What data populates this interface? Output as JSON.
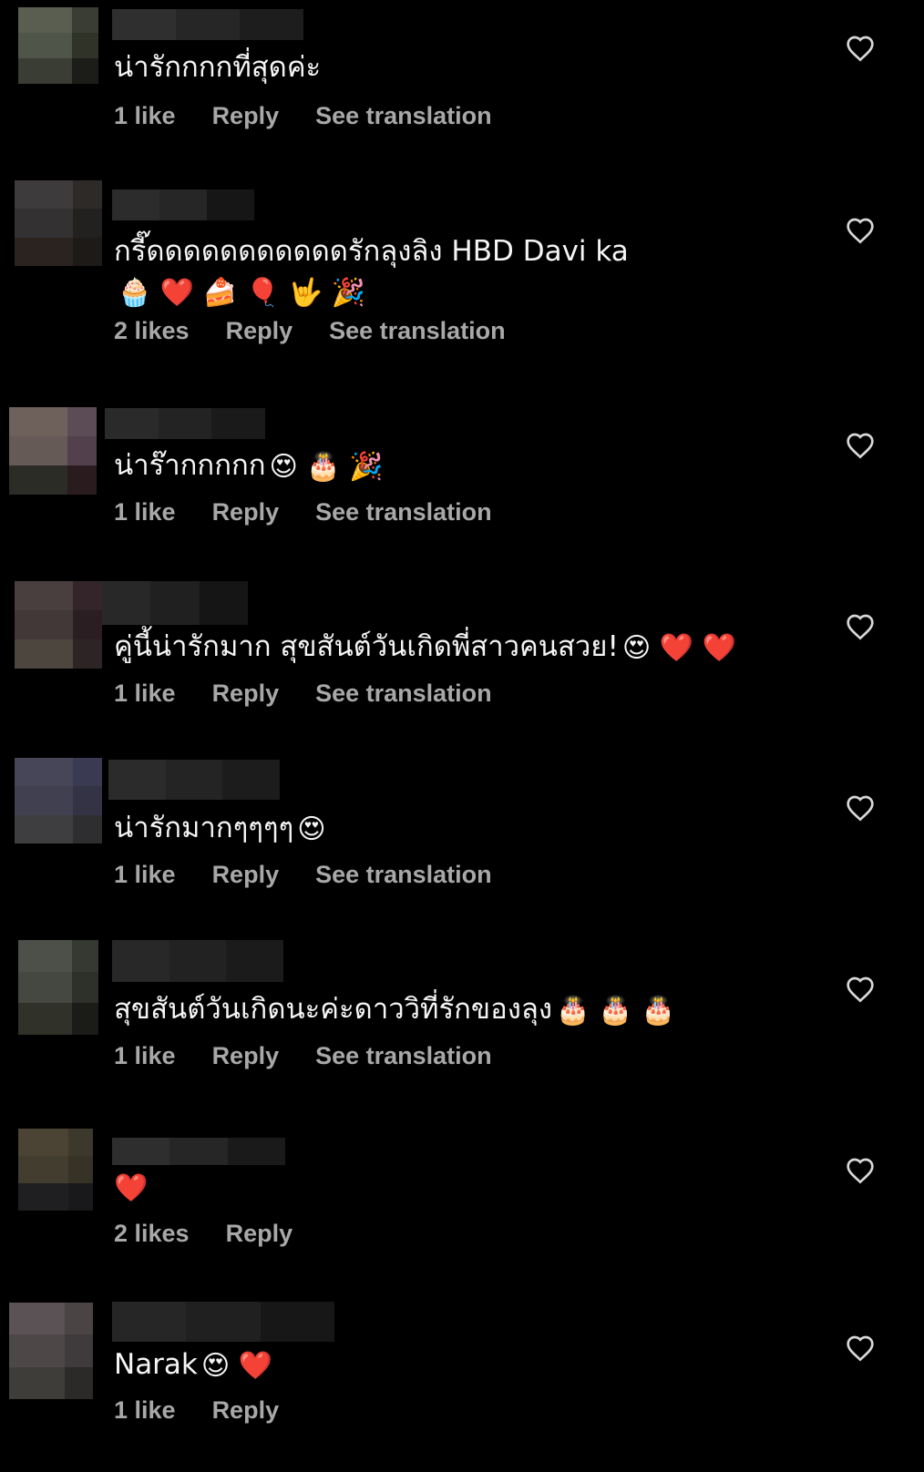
{
  "comments": [
    {
      "text": "น่ารักกกกที่สุดค่ะ",
      "emoji": "",
      "likes": "1 like",
      "reply": "Reply",
      "translation": "See translation",
      "avatar_colors": [
        "#5a5e50",
        "#5a5e50",
        "#3a3d33",
        "#50554a",
        "#50554a",
        "#303328",
        "#3a3d33",
        "#3a3d33",
        "#1c1d18"
      ],
      "bar_colors": [
        "#2f2f2f",
        "#262626",
        "#1d1d1d"
      ]
    },
    {
      "text": "กรี๊ดดดดดดดดดดดรักลุงลิง HBD Davi ka",
      "emoji": "🧁 ❤️ 🍰 🎈 🤟 🎉",
      "likes": "2 likes",
      "reply": "Reply",
      "translation": "See translation",
      "avatar_colors": [
        "#3d3b3b",
        "#3d3b3b",
        "#2e2a28",
        "#333131",
        "#333131",
        "#232020",
        "#2a2320",
        "#2a2320",
        "#1d1a18"
      ],
      "bar_colors": [
        "#2c2c2c",
        "#262626",
        "#161616"
      ]
    },
    {
      "text": "น่าร๊ากกกกก",
      "emoji": "😍 🎂 🎉",
      "likes": "1 like",
      "reply": "Reply",
      "translation": "See translation",
      "avatar_colors": [
        "#6e615b",
        "#6e615b",
        "#5c4c55",
        "#665a57",
        "#665a57",
        "#52414c",
        "#2c2c27",
        "#2c2c27",
        "#2a1c1e"
      ],
      "bar_colors": [
        "#2a2a2a",
        "#232323",
        "#1a1a1a"
      ]
    },
    {
      "text": "คู่นี้น่ารักมาก สุขสันต์วันเกิดพี่สาวคนสวย!",
      "emoji": "😍 ❤️ ❤️",
      "likes": "1 like",
      "reply": "Reply",
      "translation": "See translation",
      "avatar_colors": [
        "#4a3f3f",
        "#4a3f3f",
        "#332529",
        "#433838",
        "#433838",
        "#2a1e22",
        "#4c463f",
        "#4c463f",
        "#2d2426"
      ],
      "bar_colors": [
        "#282828",
        "#202020",
        "#151515"
      ]
    },
    {
      "text": "น่ารักมากๆๆๆๆ",
      "emoji": "😍",
      "likes": "1 like",
      "reply": "Reply",
      "translation": "See translation",
      "avatar_colors": [
        "#474659",
        "#474659",
        "#3a3a53",
        "#404050",
        "#404050",
        "#333345",
        "#3e3d3f",
        "#3e3d3f",
        "#2e2d30"
      ],
      "bar_colors": [
        "#2b2b2b",
        "#242424",
        "#1c1c1c"
      ]
    },
    {
      "text": "สุขสันต์วันเกิดนะค่ะดาววิที่รักของลุง",
      "emoji": "🎂 🎂 🎂",
      "likes": "1 like",
      "reply": "Reply",
      "translation": "See translation",
      "avatar_colors": [
        "#4d5048",
        "#4d5048",
        "#363832",
        "#454840",
        "#454840",
        "#2e302a",
        "#303128",
        "#303128",
        "#1b1c18"
      ],
      "bar_colors": [
        "#282828",
        "#222222",
        "#1b1b1b"
      ]
    },
    {
      "text": "",
      "emoji": "❤️",
      "likes": "2 likes",
      "reply": "Reply",
      "translation": "",
      "avatar_colors": [
        "#4b4434",
        "#4b4434",
        "#3d382c",
        "#433d30",
        "#433d30",
        "#373226",
        "#1f1f21",
        "#1f1f21",
        "#19191b"
      ],
      "bar_colors": [
        "#2e2e2e",
        "#262626",
        "#1a1a1a"
      ]
    },
    {
      "text": "Narak",
      "emoji": "😍 ❤️",
      "likes": "1 like",
      "reply": "Reply",
      "translation": "",
      "avatar_colors": [
        "#5a5254",
        "#5a5254",
        "#4a4445",
        "#4e4748",
        "#4e4748",
        "#3f3a3b",
        "#3f3d3a",
        "#3f3d3a",
        "#2c2a28"
      ],
      "bar_colors": [
        "#262626",
        "#202020",
        "#171717"
      ]
    }
  ],
  "icon": "heart-outline-icon",
  "colors": {
    "background": "#000000",
    "text": "#f5f5f5",
    "meta": "#a8a8a8"
  }
}
